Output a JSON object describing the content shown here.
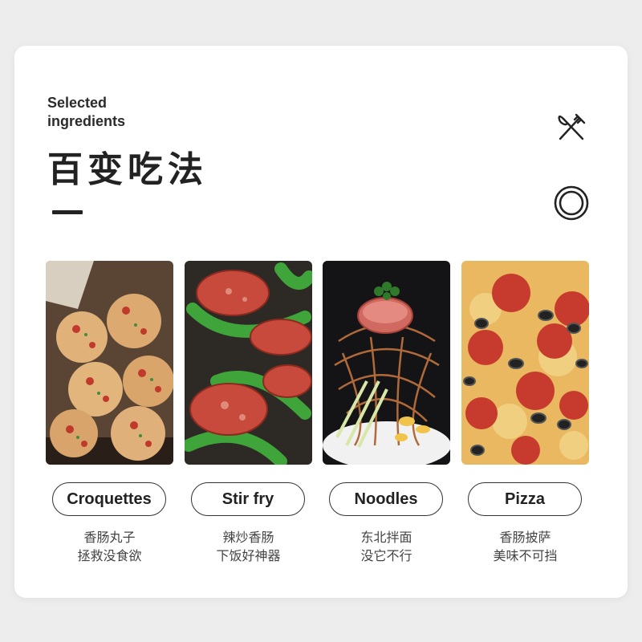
{
  "header": {
    "subtitle": "Selected\ningredients",
    "title": "百变吃法"
  },
  "icons": {
    "top": "fork-knife-icon",
    "bottom": "plate-icon"
  },
  "items": [
    {
      "label": "Croquettes",
      "line1": "香肠丸子",
      "line2": "拯救没食欲",
      "photo": "sausage-croquettes-photo"
    },
    {
      "label": "Stir fry",
      "line1": "辣炒香肠",
      "line2": "下饭好神器",
      "photo": "sausage-pepper-stirfry-photo"
    },
    {
      "label": "Noodles",
      "line1": "东北拌面",
      "line2": "没它不行",
      "photo": "sausage-noodles-photo"
    },
    {
      "label": "Pizza",
      "line1": "香肠披萨",
      "line2": "美味不可挡",
      "photo": "sausage-pizza-photo"
    }
  ],
  "colors": {
    "background": "#ededed",
    "card": "#ffffff",
    "text": "#222222"
  }
}
